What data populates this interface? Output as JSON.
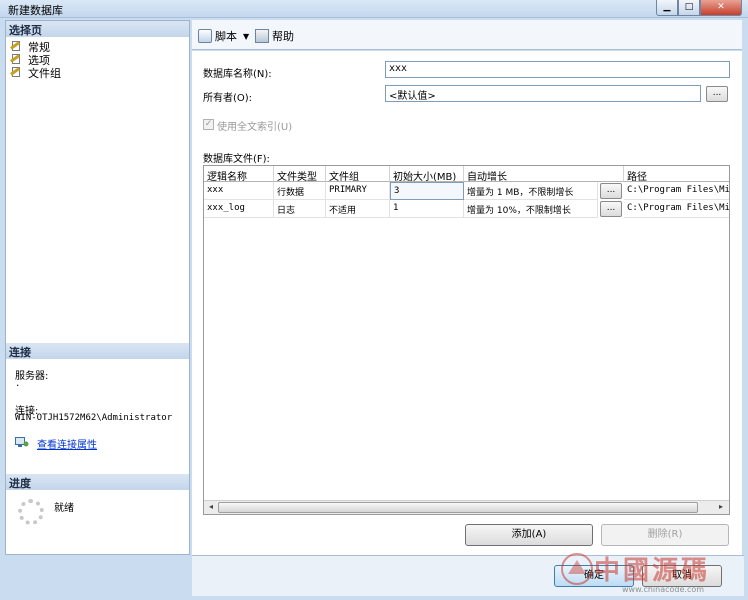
{
  "window": {
    "title": "新建数据库",
    "minimize": "▁",
    "maximize": "□",
    "close": "✕"
  },
  "left": {
    "select_page_header": "选择页",
    "pages": [
      "常规",
      "选项",
      "文件组"
    ],
    "connection_header": "连接",
    "server_label": "服务器:",
    "server_value": ".",
    "connection_label": "连接:",
    "connection_value": "WIN-OTJH1572M62\\Administrator",
    "view_props_link": "查看连接属性",
    "progress_header": "进度",
    "progress_status": "就绪"
  },
  "toolbar": {
    "script_label": "脚本",
    "script_caret": "▼",
    "help_label": "帮助"
  },
  "form": {
    "db_name_label": "数据库名称(N):",
    "db_name_value": "xxx",
    "owner_label": "所有者(O):",
    "owner_value": "<默认值>",
    "owner_browse": "...",
    "fulltext_label": "使用全文索引(U)",
    "fulltext_checked": "✓",
    "files_label": "数据库文件(F):"
  },
  "files_table": {
    "headers": [
      "逻辑名称",
      "文件类型",
      "文件组",
      "初始大小(MB)",
      "自动增长",
      "路径"
    ],
    "rows": [
      {
        "logical": "xxx",
        "type": "行数据",
        "group": "PRIMARY",
        "size": "3",
        "growth": "增量为 1 MB，不限制增长",
        "browse": "...",
        "path": "C:\\Program Files\\Micr"
      },
      {
        "logical": "xxx_log",
        "type": "日志",
        "group": "不适用",
        "size": "1",
        "growth": "增量为 10%，不限制增长",
        "browse": "...",
        "path": "C:\\Program Files\\Micr"
      }
    ],
    "scroll_left": "◂",
    "scroll_right": "▸"
  },
  "buttons": {
    "add": "添加(A)",
    "remove": "删除(R)",
    "ok": "确定",
    "cancel": "取消"
  },
  "watermark": {
    "text": "中國源碼",
    "url": "www.chinacode.com"
  }
}
